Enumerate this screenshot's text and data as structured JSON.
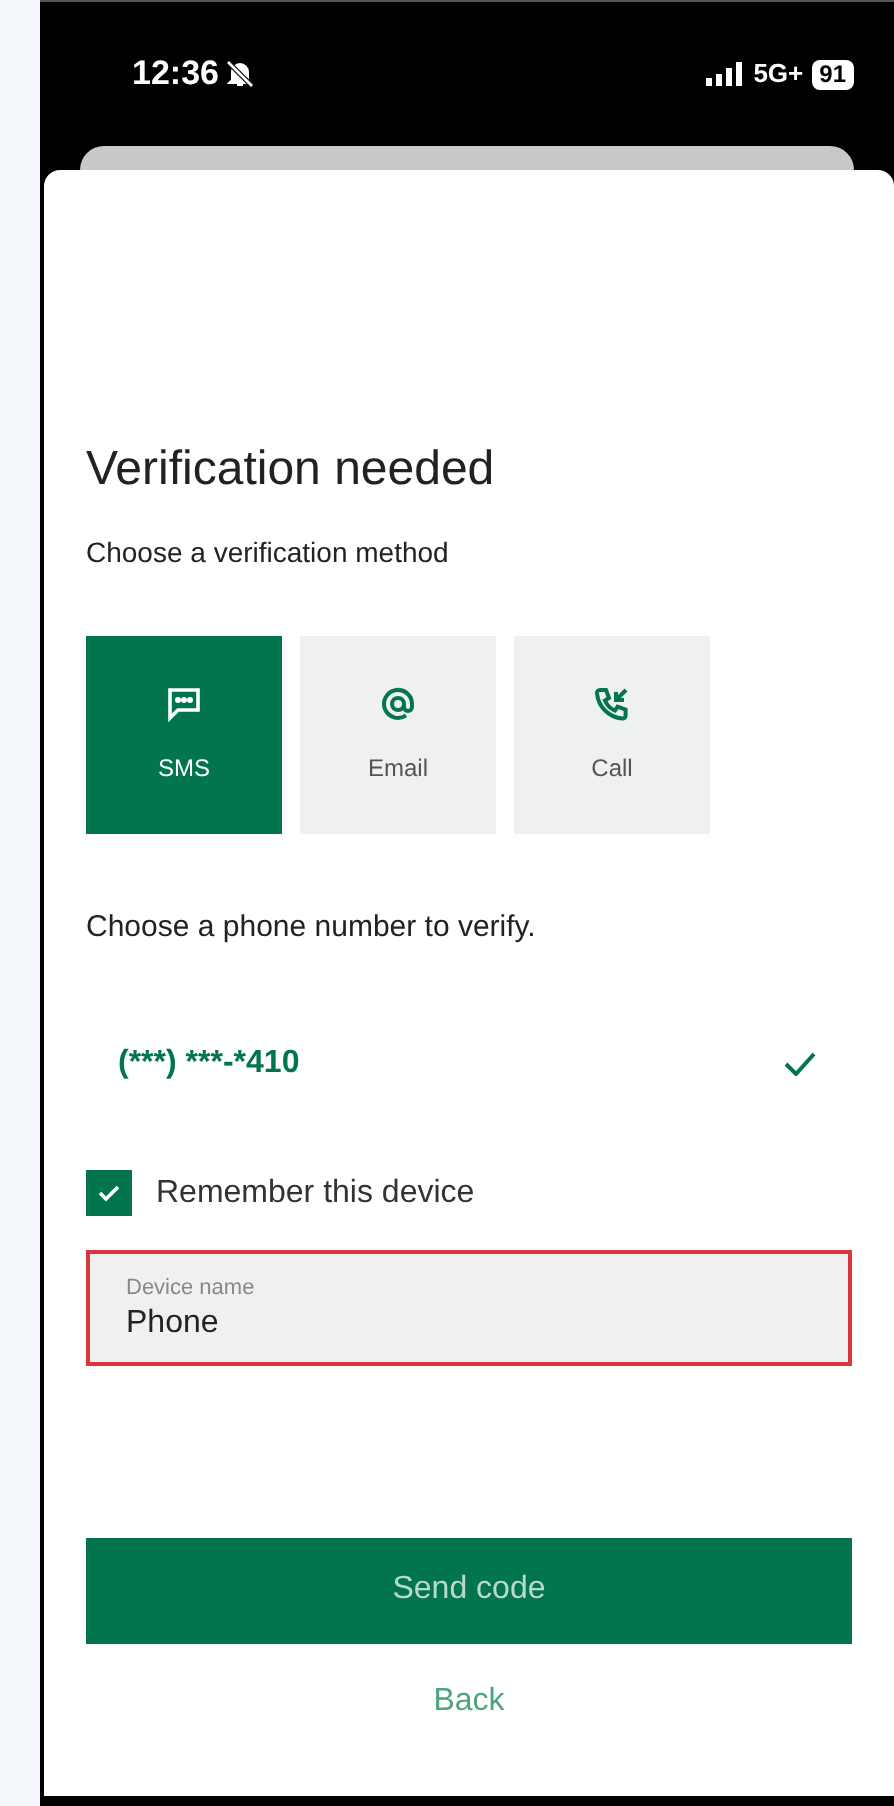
{
  "status_bar": {
    "time": "12:36",
    "silent": true,
    "network": "5G+",
    "battery": "91"
  },
  "title": "Verification needed",
  "subtitle": "Choose a verification method",
  "methods": [
    {
      "kind": "sms",
      "label": "SMS",
      "selected": true
    },
    {
      "kind": "email",
      "label": "Email",
      "selected": false
    },
    {
      "kind": "call",
      "label": "Call",
      "selected": false
    }
  ],
  "phone_prompt": "Choose a phone number to verify.",
  "phone_numbers": [
    {
      "number": "(***) ***-*410",
      "selected": true
    }
  ],
  "remember": {
    "label": "Remember this device",
    "checked": true
  },
  "device_field": {
    "label": "Device name",
    "value": "Phone",
    "error": true
  },
  "buttons": {
    "primary": "Send code",
    "secondary": "Back"
  }
}
